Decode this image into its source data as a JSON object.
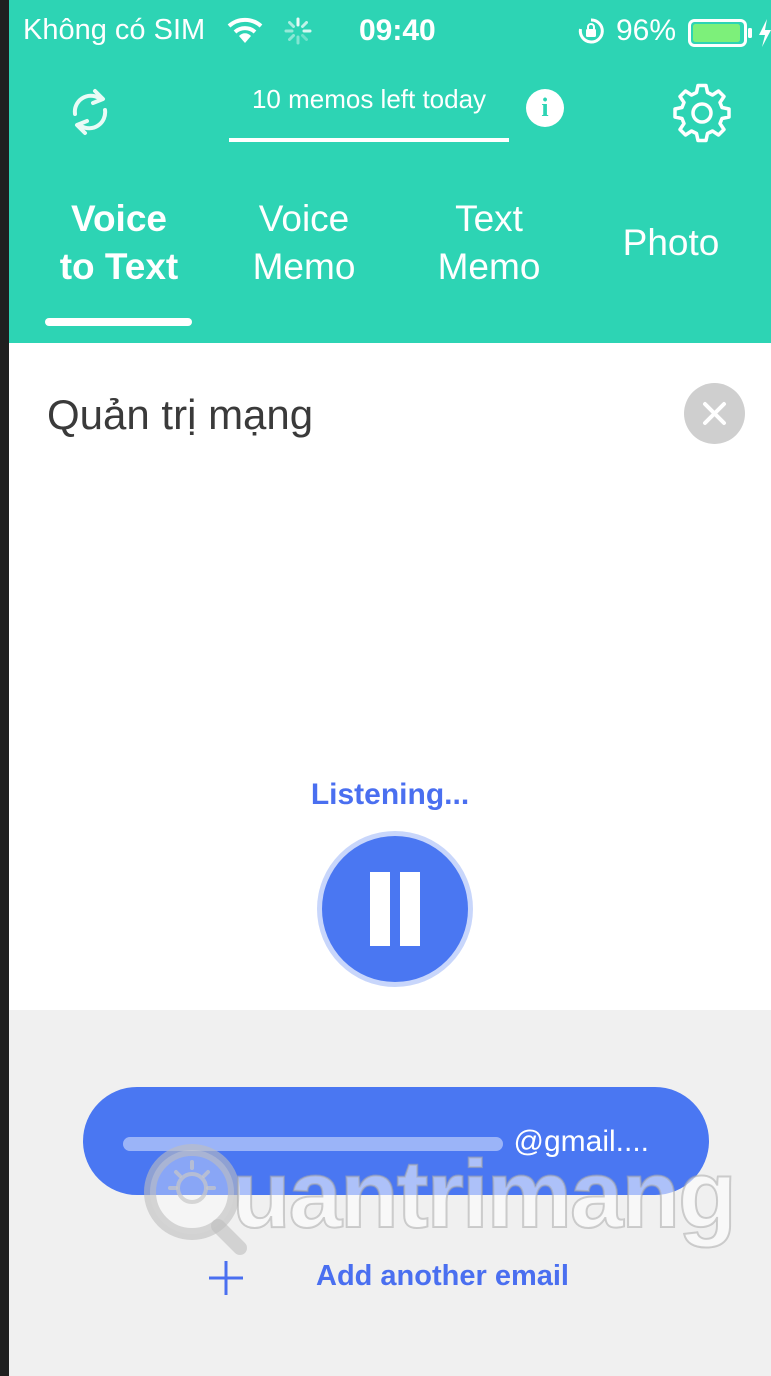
{
  "status_bar": {
    "carrier": "Không có SIM",
    "time": "09:40",
    "battery_percent": "96%",
    "battery_level": 0.96,
    "icons": [
      "wifi-icon",
      "activity-spinner-icon",
      "rotation-lock-icon",
      "battery-icon",
      "charging-bolt-icon"
    ]
  },
  "toolbar": {
    "memos_left": "10 memos left today",
    "info_icon": "i",
    "sync_icon": "sync-icon",
    "settings_icon": "gear-icon"
  },
  "tabs": [
    {
      "line1": "Voice",
      "line2": "to Text",
      "active": true
    },
    {
      "line1": "Voice",
      "line2": "Memo",
      "active": false
    },
    {
      "line1": "Text",
      "line2": "Memo",
      "active": false
    },
    {
      "line1": "Photo",
      "line2": "",
      "active": false
    }
  ],
  "memo": {
    "text": "Quản trị mạng",
    "clear_icon": "close-icon"
  },
  "recording": {
    "status": "Listening...",
    "button_icon": "pause-icon"
  },
  "email": {
    "address_visible": "@gmail....",
    "add_label": "Add another email",
    "add_icon": "plus-icon"
  },
  "watermark": {
    "text": "uantrimang",
    "logo": "quantrimang-logo"
  },
  "colors": {
    "header": "#2dd4b4",
    "accent_blue": "#4a77f2",
    "text_blue": "#4a6ff0",
    "bottom_bg": "#f0f0f0"
  }
}
